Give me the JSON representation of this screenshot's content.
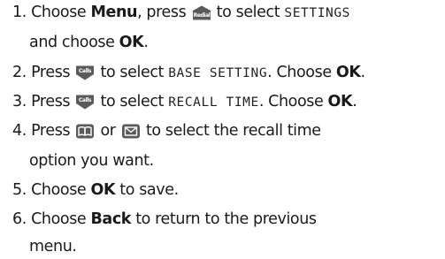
{
  "steps": [
    {
      "number": "1.",
      "parts": [
        "Choose",
        "Menu",
        ", press",
        "to select",
        "SETTINGS"
      ],
      "cont": [
        "and choose",
        "OK",
        "."
      ],
      "key": "redial-key-icon",
      "key_label": "Redial"
    },
    {
      "number": "2.",
      "parts": [
        "Press",
        "to select",
        "BASE SETTING",
        ". Choose",
        "OK",
        "."
      ],
      "key": "calls-key-icon",
      "key_label": "Calls"
    },
    {
      "number": "3.",
      "parts": [
        "Press",
        "to select",
        "RECALL TIME",
        ". Choose",
        "OK",
        "."
      ],
      "key": "calls-key-icon",
      "key_label": "Calls"
    },
    {
      "number": "4.",
      "parts": [
        "Press",
        "or",
        "to select the recall time"
      ],
      "cont": [
        "option you want."
      ],
      "keys": [
        "phonebook-key-icon",
        "message-key-icon"
      ]
    },
    {
      "number": "5.",
      "parts": [
        "Choose",
        "OK",
        "to save."
      ]
    },
    {
      "number": "6.",
      "parts": [
        "Choose",
        "Back",
        "to return to the previous"
      ],
      "cont": [
        "menu."
      ]
    }
  ],
  "colors": {
    "text": "#1a1a1a",
    "key_fill": "#5a5a5a",
    "key_text": "#ffffff"
  }
}
